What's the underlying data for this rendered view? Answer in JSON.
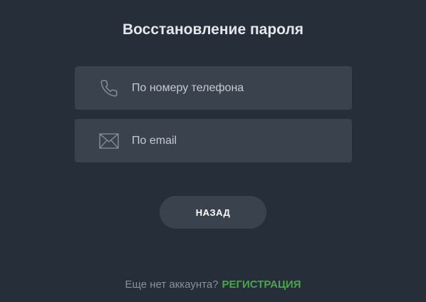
{
  "page": {
    "title": "Восстановление пароля"
  },
  "options": {
    "phone": {
      "label": "По номеру телефона",
      "icon": "phone-icon"
    },
    "email": {
      "label": "По email",
      "icon": "envelope-icon"
    }
  },
  "actions": {
    "back_label": "НАЗАД"
  },
  "footer": {
    "prompt": "Еще нет аккаунта?",
    "register_label": "РЕГИСТРАЦИЯ"
  },
  "colors": {
    "background": "#252e39",
    "card": "#3a434d",
    "accent_green": "#4ea24e",
    "title_text": "#e4e7ea",
    "muted_text": "#8a9199"
  }
}
